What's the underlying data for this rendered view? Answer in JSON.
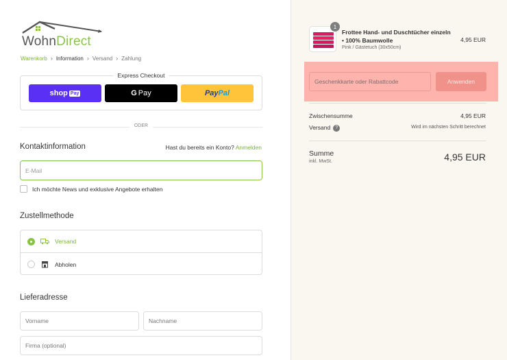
{
  "logo": {
    "text_main": "Wohn",
    "text_accent": "Direct"
  },
  "breadcrumb": {
    "items": [
      "Warenkorb",
      "Information",
      "Versand",
      "Zahlung"
    ],
    "separator": "›"
  },
  "express": {
    "title": "Express Checkout",
    "shop_label": "shop",
    "shop_badge": "Pay",
    "gpay_g": "G",
    "gpay_label": "Pay",
    "paypal_pay": "Pay",
    "paypal_pal": "Pal"
  },
  "divider_text": "ODER",
  "contact": {
    "title": "Kontaktinformation",
    "login_prompt": "Hast du bereits ein Konto?",
    "login_link": "Anmelden",
    "email_placeholder": "E-Mail",
    "newsletter_label": "Ich möchte News und exklusive Angebote erhalten"
  },
  "delivery": {
    "title": "Zustellmethode",
    "options": [
      {
        "label": "Versand",
        "selected": true,
        "icon": "truck-icon"
      },
      {
        "label": "Abholen",
        "selected": false,
        "icon": "store-icon"
      }
    ]
  },
  "address": {
    "title": "Lieferadresse",
    "firstname_placeholder": "Vorname",
    "lastname_placeholder": "Nachname",
    "company_placeholder": "Firma (optional)"
  },
  "summary": {
    "product": {
      "qty": "1",
      "name": "Frottee Hand- und Duschtücher einzeln • 100% Baumwolle",
      "variant": "Pink / Gästetuch (30x50cm)",
      "price": "4,95 EUR"
    },
    "discount_placeholder": "Geschenkkarte oder Rabattcode",
    "apply_label": "Anwenden",
    "subtotal_label": "Zwischensumme",
    "subtotal_value": "4,95 EUR",
    "shipping_label": "Versand",
    "shipping_note": "Wird im nächsten Schritt berechnet",
    "total_label": "Summe",
    "total_sub": "inkl. MwSt.",
    "total_value": "4,95 EUR"
  },
  "colors": {
    "accent": "#8bc34a",
    "link": "#7ab33b",
    "discount_highlight": "#ffb3ad",
    "apply_button": "#f0928a"
  }
}
